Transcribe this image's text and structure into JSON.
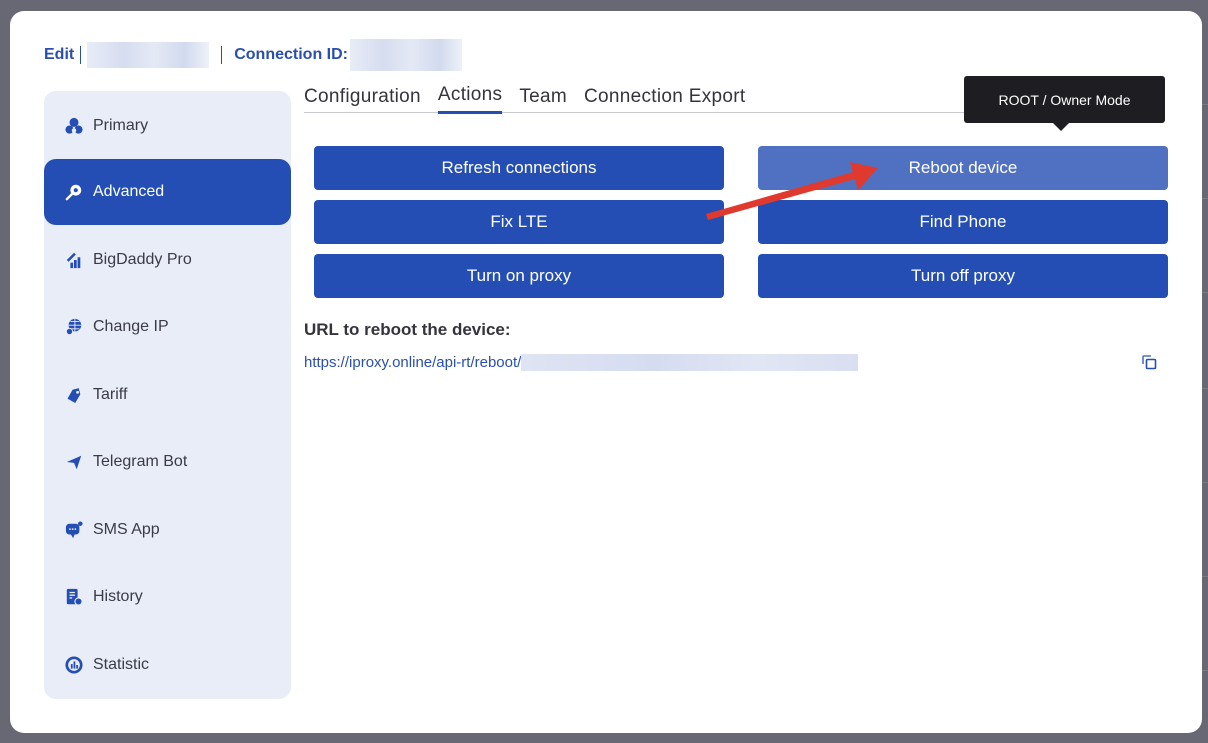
{
  "header": {
    "edit_label": "Edit",
    "connection_id_label": "Connection ID:"
  },
  "sidebar": {
    "items": [
      {
        "label": "Primary",
        "icon": "users-icon",
        "active": false
      },
      {
        "label": "Advanced",
        "icon": "search-gear-icon",
        "active": true
      },
      {
        "label": "BigDaddy Pro",
        "icon": "rocket-bars-icon",
        "active": false
      },
      {
        "label": "Change IP",
        "icon": "globe-user-icon",
        "active": false
      },
      {
        "label": "Tariff",
        "icon": "tag-icon",
        "active": false
      },
      {
        "label": "Telegram Bot",
        "icon": "paper-plane-icon",
        "active": false
      },
      {
        "label": "SMS App",
        "icon": "chat-bubble-icon",
        "active": false
      },
      {
        "label": "History",
        "icon": "document-clock-icon",
        "active": false
      },
      {
        "label": "Statistic",
        "icon": "chart-circle-icon",
        "active": false
      }
    ]
  },
  "tabs": [
    {
      "label": "Configuration",
      "active": false
    },
    {
      "label": "Actions",
      "active": true
    },
    {
      "label": "Team",
      "active": false
    },
    {
      "label": "Connection Export",
      "active": false
    }
  ],
  "actions": {
    "refresh_connections": "Refresh connections",
    "reboot_device": "Reboot device",
    "fix_lte": "Fix LTE",
    "find_phone": "Find Phone",
    "turn_on_proxy": "Turn on proxy",
    "turn_off_proxy": "Turn off proxy"
  },
  "tooltip": {
    "text": "ROOT / Owner Mode"
  },
  "reboot_url": {
    "label": "URL to reboot the device:",
    "value": "https://iproxy.online/api-rt/reboot/"
  },
  "colors": {
    "primary": "#244eb3",
    "hover": "#5070c2",
    "sidebar_bg": "#e8edf8",
    "annotation_arrow": "#e03a2f"
  }
}
